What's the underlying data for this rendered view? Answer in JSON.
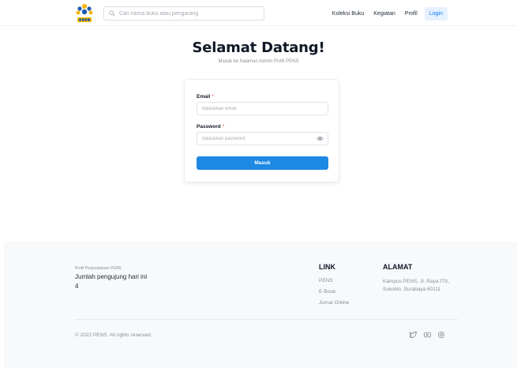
{
  "header": {
    "search_placeholder": "Cari nama buku atau pengarang",
    "nav": [
      "Koleksi Buku",
      "Kegiatan",
      "Profil"
    ],
    "login_label": "Login"
  },
  "main": {
    "title": "Selamat Datang!",
    "subtitle": "Masuk ke halaman Admin Profil PENS",
    "form": {
      "email_label": "Email",
      "email_placeholder": "Masukkan email",
      "password_label": "Password",
      "password_placeholder": "Masukkan password",
      "required_mark": "*",
      "submit_label": "Masuk"
    }
  },
  "footer": {
    "brand_small": "Profil Perpustakaan PENS",
    "visitors_label": "Jumlah pengujung hari ini",
    "visitors_count": "4",
    "link_heading": "LINK",
    "links": [
      "PENS",
      "E-Book",
      "Jurnal Online"
    ],
    "address_heading": "ALAMAT",
    "address": "Kampus PENS, Jl. Raya ITS, Sukolilo, Surabaya 60111",
    "copyright": "© 2022 PENS. All rights reserved.",
    "social_icons": [
      "twitter-icon",
      "youtube-icon",
      "instagram-icon"
    ]
  },
  "colors": {
    "primary": "#1e88e5",
    "login_bg": "#e6f1ff",
    "logo_blue": "#1e5aa8",
    "logo_yellow": "#f5b400"
  }
}
